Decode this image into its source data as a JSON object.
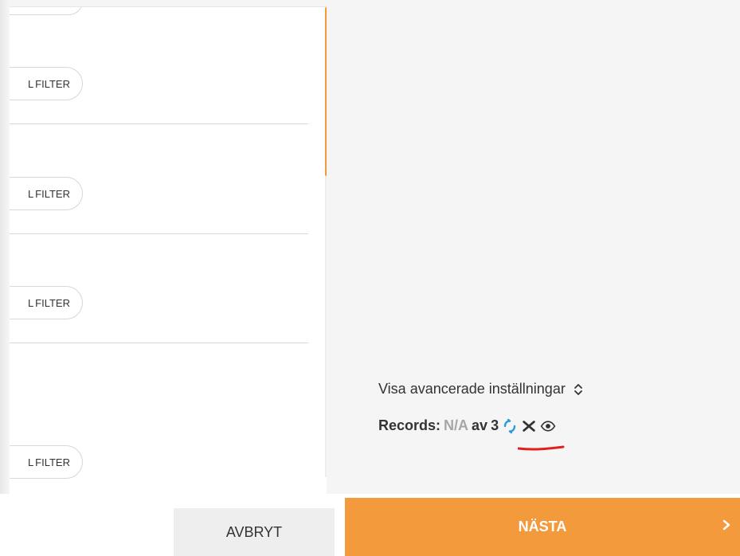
{
  "left_panel": {
    "filter_label": "FILTER",
    "filter_prefix": "L"
  },
  "right_panel": {
    "advanced_settings_label": "Visa avancerade inställningar",
    "records_label": "Records:",
    "records_value": "N/A",
    "records_of": "av",
    "records_total": "3",
    "icons": {
      "refresh": "refresh-icon",
      "clear": "clear-icon",
      "view": "eye-icon"
    }
  },
  "footer": {
    "cancel_label": "AVBRYT",
    "next_label": "NÄSTA"
  },
  "colors": {
    "accent": "#f39a3c",
    "annotation": "#e21f1f"
  }
}
